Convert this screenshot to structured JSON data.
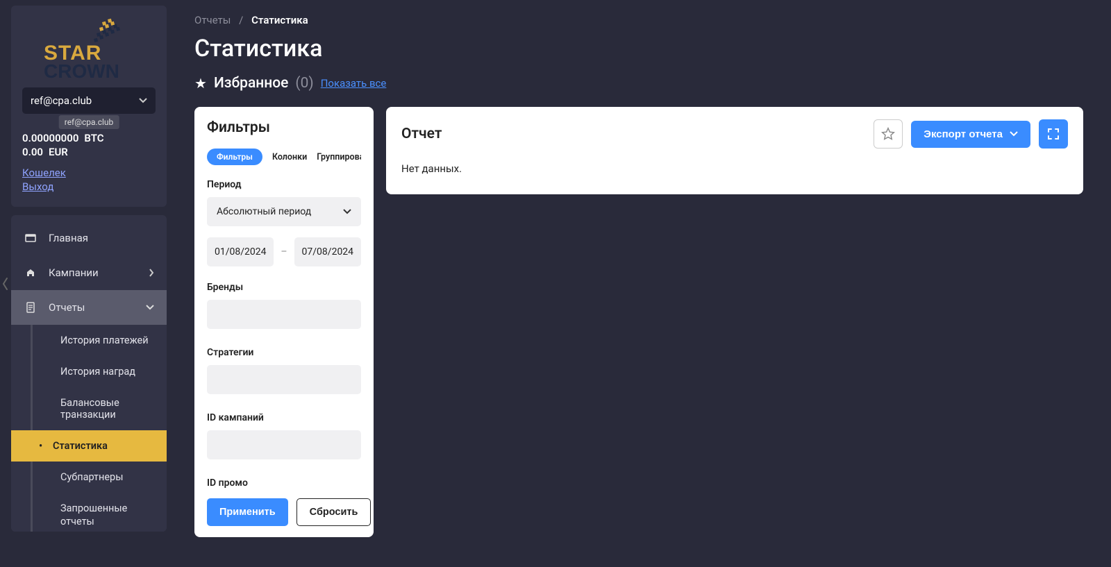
{
  "account": {
    "email": "ref@cpa.club",
    "tooltip": "ref@cpa.club",
    "btc_value": "0.00000000",
    "btc_currency": "BTC",
    "eur_value": "0.00",
    "eur_currency": "EUR",
    "wallet_link": "Кошелек",
    "logout_link": "Выход"
  },
  "nav": {
    "home": "Главная",
    "campaigns": "Кампании",
    "reports": "Отчеты",
    "sub": {
      "payment_history": "История платежей",
      "rewards_history": "История наград",
      "balance_tx": "Балансовые транзакции",
      "statistics": "Статистика",
      "subpartners": "Субпартнеры",
      "requested": "Запрошенные отчеты"
    }
  },
  "breadcrumb": {
    "root": "Отчеты",
    "current": "Статистика"
  },
  "page": {
    "title": "Статистика"
  },
  "favorites": {
    "label": "Избранное",
    "count": "(0)",
    "show_all": "Показать все"
  },
  "filters": {
    "panel_title": "Фильтры",
    "tabs": {
      "filters": "Фильтры",
      "columns": "Колонки",
      "group": "Группировать"
    },
    "period_label": "Период",
    "period_select": "Абсолютный период",
    "date_from": "01/08/2024",
    "date_sep": "–",
    "date_to": "07/08/2024",
    "brands_label": "Бренды",
    "strategies_label": "Стратегии",
    "campaign_ids_label": "ID кампаний",
    "promo_ids_label": "ID промо",
    "apply": "Применить",
    "reset": "Сбросить"
  },
  "report": {
    "title": "Отчет",
    "export": "Экспорт отчета",
    "no_data": "Нет данных."
  }
}
